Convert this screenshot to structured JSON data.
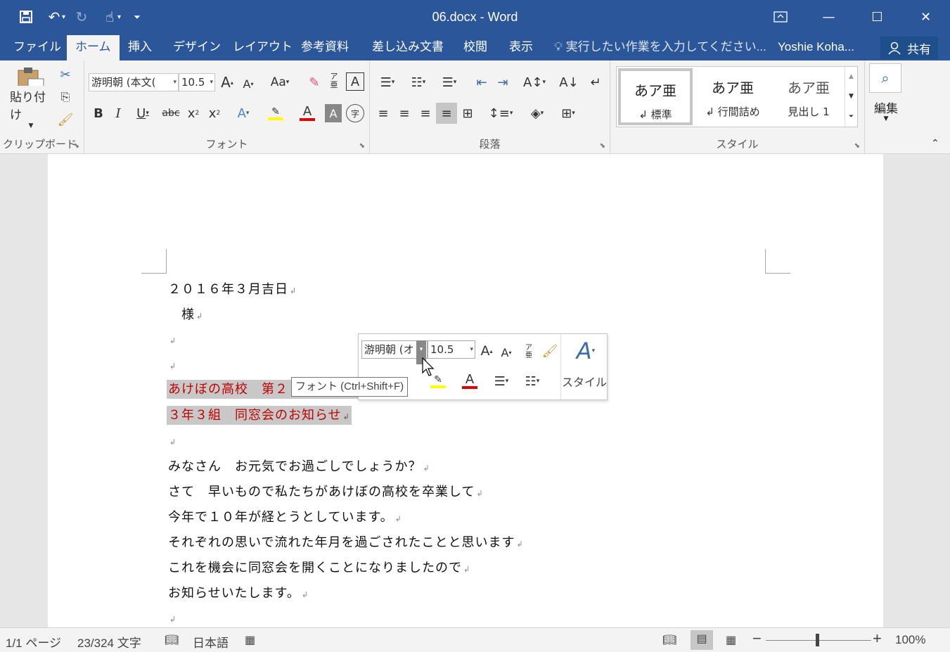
{
  "window": {
    "title": "06.docx - Word",
    "controls": [
      "restore-ribbon",
      "minimize",
      "maximize",
      "close"
    ]
  },
  "qat": {
    "save_icon": "save-icon",
    "undo_icon": "undo-icon",
    "redo_icon": "redo-icon",
    "touch_icon": "touch-mode-icon"
  },
  "tabs": [
    {
      "label": "ファイル"
    },
    {
      "label": "ホーム"
    },
    {
      "label": "挿入"
    },
    {
      "label": "デザイン"
    },
    {
      "label": "レイアウト"
    },
    {
      "label": "参考資料"
    },
    {
      "label": "差し込み文書"
    },
    {
      "label": "校閲"
    },
    {
      "label": "表示"
    }
  ],
  "active_tab": "ホーム",
  "tellme": "実行したい作業を入力してください...",
  "user": "Yoshie Koha...",
  "share_label": "共有",
  "ribbon": {
    "clipboard": {
      "paste_label": "貼り付け",
      "group_label": "クリップボード"
    },
    "font": {
      "font_name": "游明朝 (本文(",
      "font_size": "10.5",
      "case_label": "Aa",
      "group_label": "フォント",
      "ruby_top": "ア",
      "ruby_bottom": "亜"
    },
    "paragraph": {
      "group_label": "段落"
    },
    "styles": {
      "items": [
        {
          "sample": "あア亜",
          "name": "↲ 標準"
        },
        {
          "sample": "あア亜",
          "name": "↲ 行間詰め"
        },
        {
          "sample": "あア亜",
          "name": "見出し 1"
        }
      ],
      "group_label": "スタイル"
    },
    "editing": {
      "label": "編集"
    }
  },
  "document": {
    "lines": [
      {
        "text": "２０１６年３月吉日",
        "mark": "↲"
      },
      {
        "text": "　様",
        "mark": "↲"
      },
      {
        "text": "",
        "mark": "↲"
      },
      {
        "text": "",
        "mark": "↲"
      },
      {
        "text": "あけぼの高校　第２",
        "mark": "",
        "highlight": true
      },
      {
        "text": "３年３組　同窓会のお知らせ",
        "mark": "↲",
        "highlight": true
      },
      {
        "text": "",
        "mark": "↲"
      },
      {
        "text": "みなさん　お元気でお過ごしでしょうか？",
        "mark": "↲"
      },
      {
        "text": "さて　早いもので私たちがあけぼの高校を卒業して",
        "mark": "↲"
      },
      {
        "text": "今年で１０年が経とうとしています。",
        "mark": "↲"
      },
      {
        "text": "それぞれの思いで流れた年月を過ごされたことと思います",
        "mark": "↲"
      },
      {
        "text": "これを機会に同窓会を開くことになりましたので",
        "mark": "↲"
      },
      {
        "text": "お知らせいたします。",
        "mark": "↲"
      },
      {
        "text": "",
        "mark": "↲"
      }
    ]
  },
  "minitoolbar": {
    "font_name": "游明朝 (オ",
    "font_size": "10.5",
    "styles_label": "スタイル"
  },
  "tooltip": "フォント (Ctrl+Shift+F)",
  "status": {
    "page": "1/1 ページ",
    "words": "23/324 文字",
    "language": "日本語",
    "zoom": "100%",
    "zoom_minus": "−",
    "zoom_plus": "+"
  },
  "colors": {
    "brand": "#2b579a",
    "highlight_text": "#c00000",
    "selection": "#c8c8c8"
  }
}
